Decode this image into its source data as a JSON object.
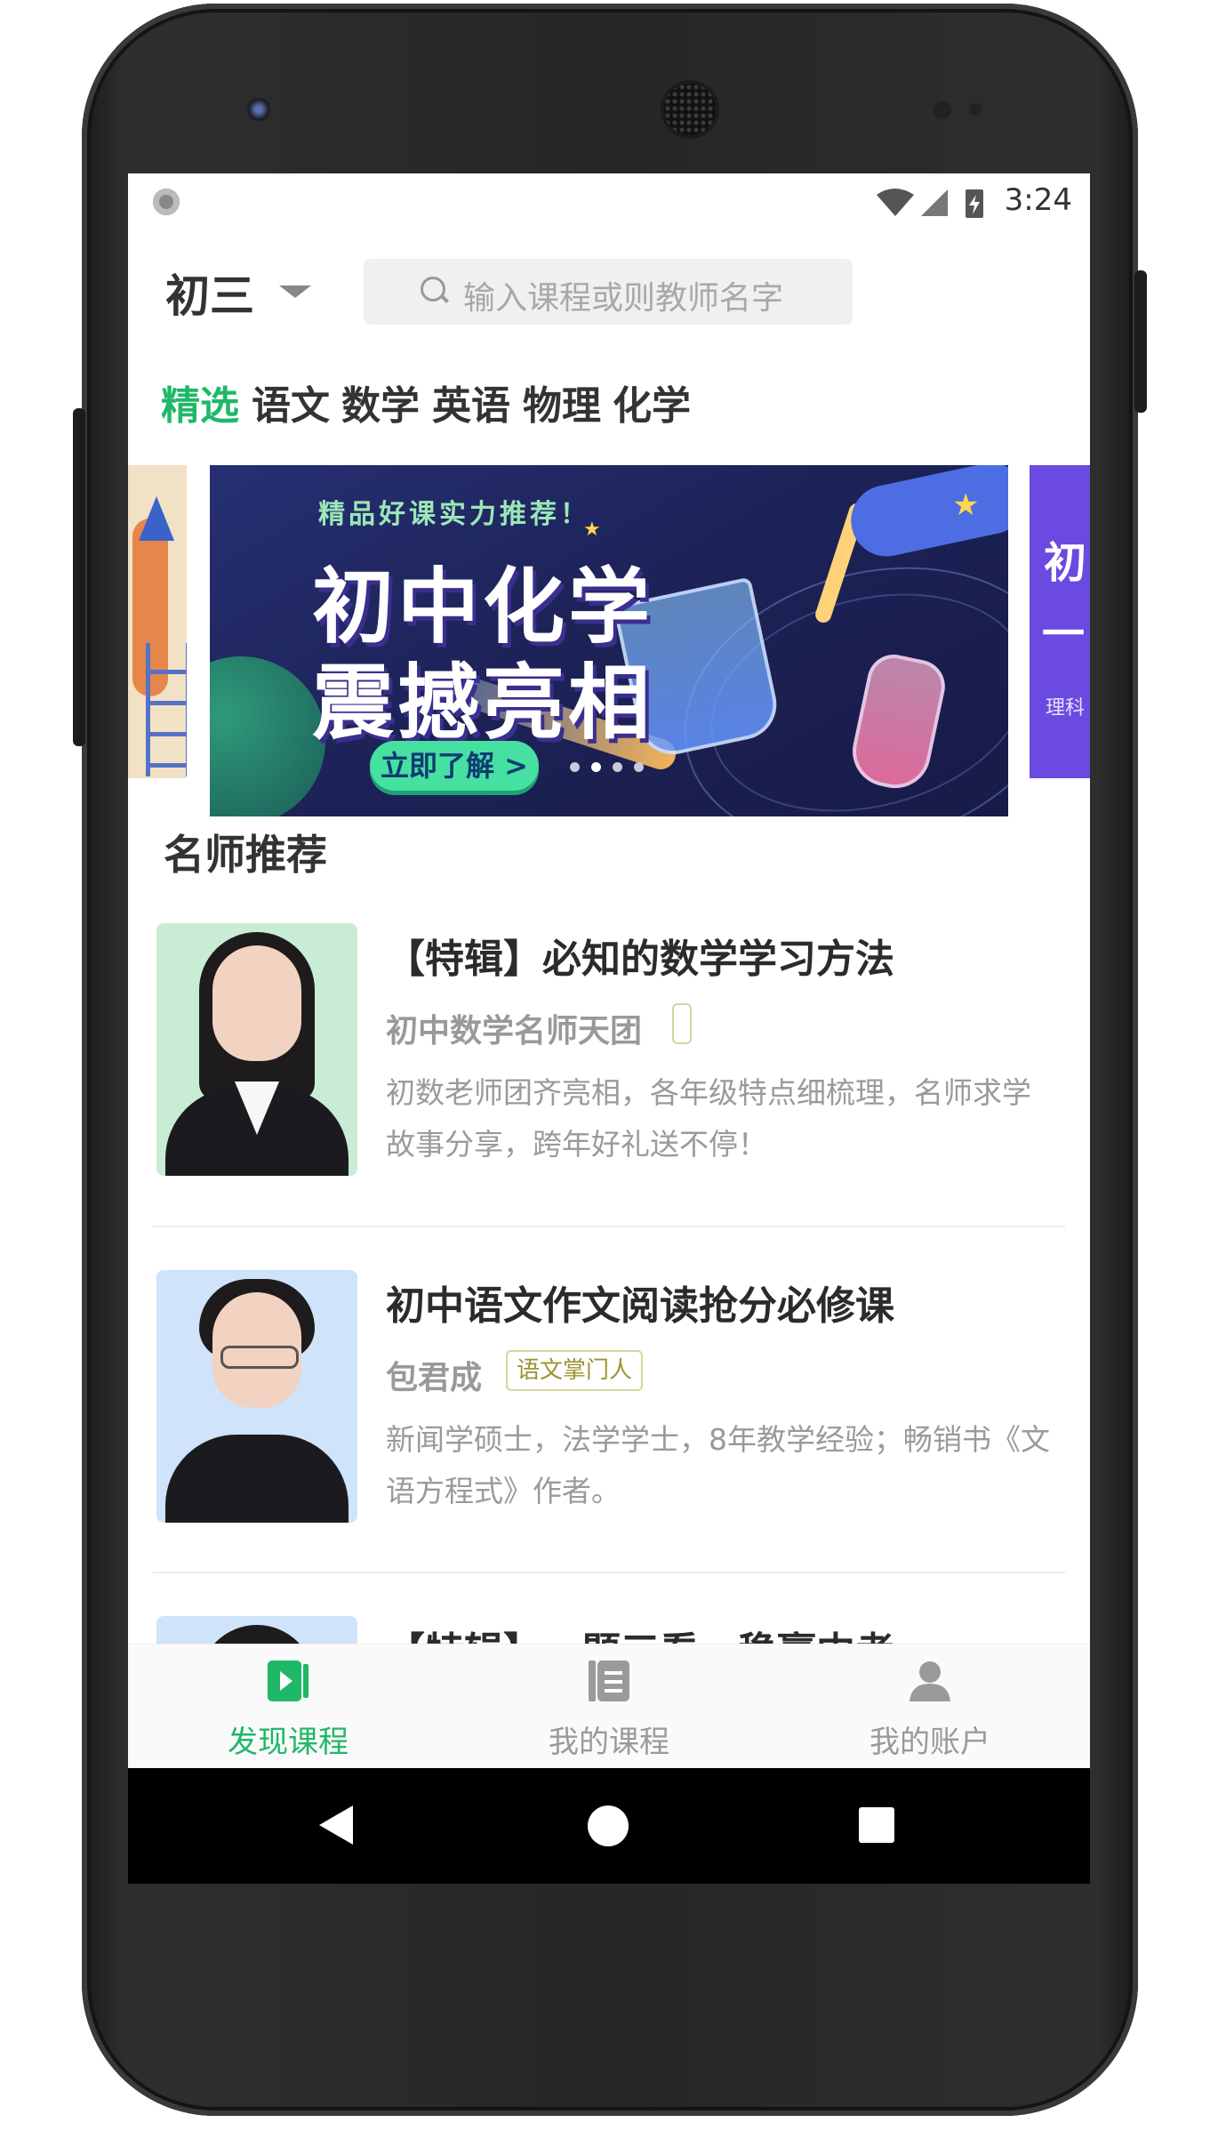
{
  "status_bar": {
    "time": "3:24"
  },
  "header": {
    "grade": "初三",
    "search_placeholder": "输入课程或则教师名字"
  },
  "tabs": [
    {
      "label": "精选",
      "active": true
    },
    {
      "label": "语文",
      "active": false
    },
    {
      "label": "数学",
      "active": false
    },
    {
      "label": "英语",
      "active": false
    },
    {
      "label": "物理",
      "active": false
    },
    {
      "label": "化学",
      "active": false
    }
  ],
  "banner": {
    "tagline": "精品好课实力推荐！",
    "headline_1": "初中化学",
    "headline_2": "震撼亮相",
    "cta": "立即了解 >",
    "dots": 4,
    "active_dot": 2,
    "next_banner": {
      "line1": "初",
      "line2": "一",
      "line3": "理科"
    }
  },
  "section": {
    "title": "名师推荐"
  },
  "courses": [
    {
      "title": "【特辑】必知的数学学习方法",
      "teacher": "初中数学名师天团",
      "badge": "",
      "desc": "初数老师团齐亮相，各年级特点细梳理，名师求学故事分享，跨年好礼送不停！",
      "photo_bg": "#c8ecd4"
    },
    {
      "title": "初中语文作文阅读抢分必修课",
      "teacher": "包君成",
      "badge": "语文掌门人",
      "desc": "新闻学硕士，法学学士，8年教学经验；畅销书《文语方程式》作者。",
      "photo_bg": "#cfe3fb"
    },
    {
      "title": "【特辑】一题三看，稳赢中考",
      "teacher": "",
      "badge": "",
      "desc": "",
      "photo_bg": "#cfe3fb"
    }
  ],
  "bottom_nav": [
    {
      "label": "发现课程",
      "icon": "play-book-icon",
      "active": true
    },
    {
      "label": "我的课程",
      "icon": "notebook-icon",
      "active": false
    },
    {
      "label": "我的账户",
      "icon": "user-icon",
      "active": false
    }
  ],
  "colors": {
    "accent": "#1fb868",
    "text": "#2b2b2b",
    "muted": "#9a9a9a"
  }
}
